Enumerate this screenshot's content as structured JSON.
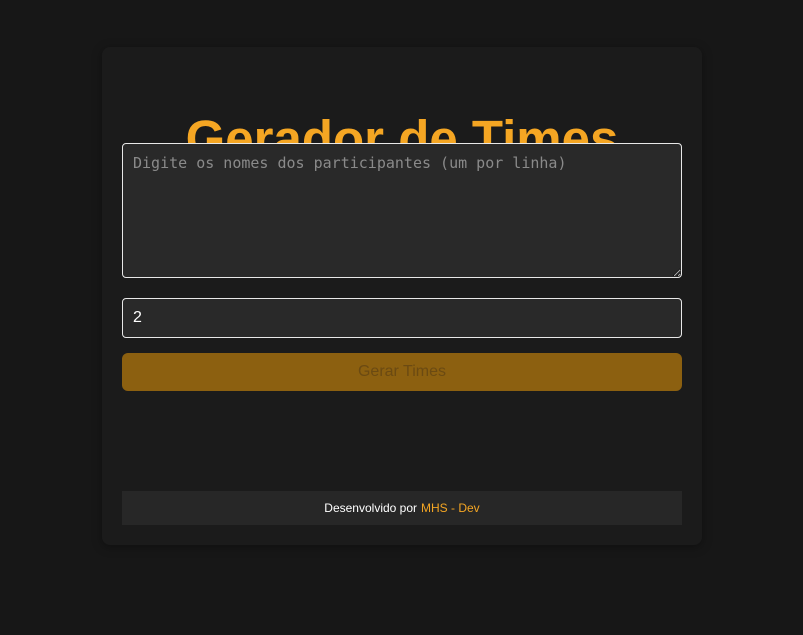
{
  "app": {
    "title": "Gerador de Times"
  },
  "form": {
    "names_placeholder": "Digite os nomes dos participantes (um por linha)",
    "names_value": "",
    "team_count_value": "2",
    "generate_label": "Gerar Times"
  },
  "footer": {
    "prefix": "Desenvolvido por",
    "link_label": "MHS - Dev"
  },
  "colors": {
    "accent": "#f5a623",
    "background": "#171717",
    "card": "#1b1b1b",
    "button_disabled": "#8c6010"
  }
}
